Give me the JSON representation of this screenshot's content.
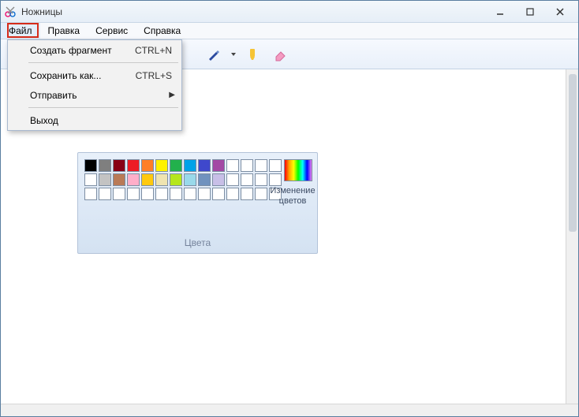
{
  "window": {
    "title": "Ножницы"
  },
  "menubar": {
    "items": [
      {
        "label": "Файл"
      },
      {
        "label": "Правка"
      },
      {
        "label": "Сервис"
      },
      {
        "label": "Справка"
      }
    ]
  },
  "file_menu": {
    "new": {
      "label": "Создать фрагмент",
      "shortcut": "CTRL+N"
    },
    "saveas": {
      "label": "Сохранить как...",
      "shortcut": "CTRL+S"
    },
    "send": {
      "label": "Отправить"
    },
    "exit": {
      "label": "Выход"
    }
  },
  "colorpanel": {
    "title": "Цвета",
    "change_label_1": "Изменение",
    "change_label_2": "цветов",
    "row1": [
      "#000000",
      "#7f7f7f",
      "#880015",
      "#ed1c24",
      "#ff7f27",
      "#fff200",
      "#22b14c",
      "#00a2e8",
      "#3f48cc",
      "#a349a4"
    ],
    "row2": [
      "#ffffff",
      "#c3c3c3",
      "#b97a57",
      "#ffaec9",
      "#ffc90e",
      "#efe4b0",
      "#b5e61d",
      "#99d9ea",
      "#7092be",
      "#c8bfe7"
    ]
  }
}
